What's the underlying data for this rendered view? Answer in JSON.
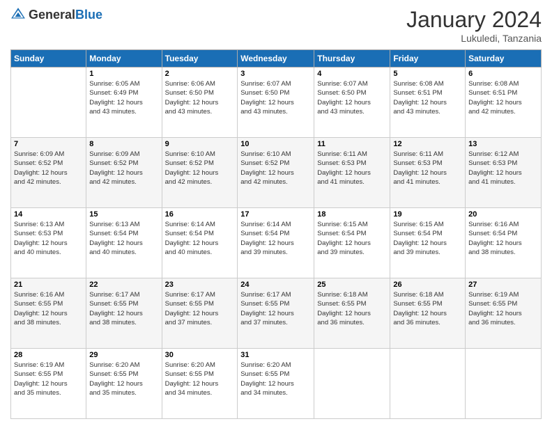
{
  "header": {
    "logo_general": "General",
    "logo_blue": "Blue",
    "month_title": "January 2024",
    "location": "Lukuledi, Tanzania"
  },
  "days_of_week": [
    "Sunday",
    "Monday",
    "Tuesday",
    "Wednesday",
    "Thursday",
    "Friday",
    "Saturday"
  ],
  "weeks": [
    [
      {
        "day": "",
        "sunrise": "",
        "sunset": "",
        "daylight": ""
      },
      {
        "day": "1",
        "sunrise": "6:05 AM",
        "sunset": "6:49 PM",
        "daylight": "12 hours and 43 minutes."
      },
      {
        "day": "2",
        "sunrise": "6:06 AM",
        "sunset": "6:50 PM",
        "daylight": "12 hours and 43 minutes."
      },
      {
        "day": "3",
        "sunrise": "6:07 AM",
        "sunset": "6:50 PM",
        "daylight": "12 hours and 43 minutes."
      },
      {
        "day": "4",
        "sunrise": "6:07 AM",
        "sunset": "6:50 PM",
        "daylight": "12 hours and 43 minutes."
      },
      {
        "day": "5",
        "sunrise": "6:08 AM",
        "sunset": "6:51 PM",
        "daylight": "12 hours and 43 minutes."
      },
      {
        "day": "6",
        "sunrise": "6:08 AM",
        "sunset": "6:51 PM",
        "daylight": "12 hours and 42 minutes."
      }
    ],
    [
      {
        "day": "7",
        "sunrise": "6:09 AM",
        "sunset": "6:52 PM",
        "daylight": "12 hours and 42 minutes."
      },
      {
        "day": "8",
        "sunrise": "6:09 AM",
        "sunset": "6:52 PM",
        "daylight": "12 hours and 42 minutes."
      },
      {
        "day": "9",
        "sunrise": "6:10 AM",
        "sunset": "6:52 PM",
        "daylight": "12 hours and 42 minutes."
      },
      {
        "day": "10",
        "sunrise": "6:10 AM",
        "sunset": "6:52 PM",
        "daylight": "12 hours and 42 minutes."
      },
      {
        "day": "11",
        "sunrise": "6:11 AM",
        "sunset": "6:53 PM",
        "daylight": "12 hours and 41 minutes."
      },
      {
        "day": "12",
        "sunrise": "6:11 AM",
        "sunset": "6:53 PM",
        "daylight": "12 hours and 41 minutes."
      },
      {
        "day": "13",
        "sunrise": "6:12 AM",
        "sunset": "6:53 PM",
        "daylight": "12 hours and 41 minutes."
      }
    ],
    [
      {
        "day": "14",
        "sunrise": "6:13 AM",
        "sunset": "6:53 PM",
        "daylight": "12 hours and 40 minutes."
      },
      {
        "day": "15",
        "sunrise": "6:13 AM",
        "sunset": "6:54 PM",
        "daylight": "12 hours and 40 minutes."
      },
      {
        "day": "16",
        "sunrise": "6:14 AM",
        "sunset": "6:54 PM",
        "daylight": "12 hours and 40 minutes."
      },
      {
        "day": "17",
        "sunrise": "6:14 AM",
        "sunset": "6:54 PM",
        "daylight": "12 hours and 39 minutes."
      },
      {
        "day": "18",
        "sunrise": "6:15 AM",
        "sunset": "6:54 PM",
        "daylight": "12 hours and 39 minutes."
      },
      {
        "day": "19",
        "sunrise": "6:15 AM",
        "sunset": "6:54 PM",
        "daylight": "12 hours and 39 minutes."
      },
      {
        "day": "20",
        "sunrise": "6:16 AM",
        "sunset": "6:54 PM",
        "daylight": "12 hours and 38 minutes."
      }
    ],
    [
      {
        "day": "21",
        "sunrise": "6:16 AM",
        "sunset": "6:55 PM",
        "daylight": "12 hours and 38 minutes."
      },
      {
        "day": "22",
        "sunrise": "6:17 AM",
        "sunset": "6:55 PM",
        "daylight": "12 hours and 38 minutes."
      },
      {
        "day": "23",
        "sunrise": "6:17 AM",
        "sunset": "6:55 PM",
        "daylight": "12 hours and 37 minutes."
      },
      {
        "day": "24",
        "sunrise": "6:17 AM",
        "sunset": "6:55 PM",
        "daylight": "12 hours and 37 minutes."
      },
      {
        "day": "25",
        "sunrise": "6:18 AM",
        "sunset": "6:55 PM",
        "daylight": "12 hours and 36 minutes."
      },
      {
        "day": "26",
        "sunrise": "6:18 AM",
        "sunset": "6:55 PM",
        "daylight": "12 hours and 36 minutes."
      },
      {
        "day": "27",
        "sunrise": "6:19 AM",
        "sunset": "6:55 PM",
        "daylight": "12 hours and 36 minutes."
      }
    ],
    [
      {
        "day": "28",
        "sunrise": "6:19 AM",
        "sunset": "6:55 PM",
        "daylight": "12 hours and 35 minutes."
      },
      {
        "day": "29",
        "sunrise": "6:20 AM",
        "sunset": "6:55 PM",
        "daylight": "12 hours and 35 minutes."
      },
      {
        "day": "30",
        "sunrise": "6:20 AM",
        "sunset": "6:55 PM",
        "daylight": "12 hours and 34 minutes."
      },
      {
        "day": "31",
        "sunrise": "6:20 AM",
        "sunset": "6:55 PM",
        "daylight": "12 hours and 34 minutes."
      },
      {
        "day": "",
        "sunrise": "",
        "sunset": "",
        "daylight": ""
      },
      {
        "day": "",
        "sunrise": "",
        "sunset": "",
        "daylight": ""
      },
      {
        "day": "",
        "sunrise": "",
        "sunset": "",
        "daylight": ""
      }
    ]
  ],
  "labels": {
    "sunrise_prefix": "Sunrise: ",
    "sunset_prefix": "Sunset: ",
    "daylight_prefix": "Daylight: "
  }
}
